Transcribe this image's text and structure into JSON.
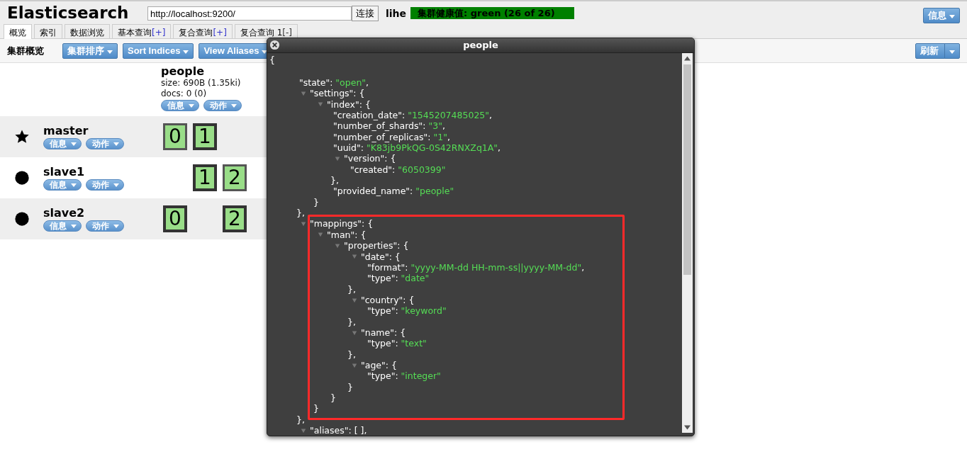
{
  "header": {
    "title": "Elasticsearch",
    "url": "http://localhost:9200/",
    "connect_button": "连接",
    "cluster_name": "lihe",
    "health": "集群健康值: green (26 of 26)",
    "info_button": "信息"
  },
  "tabs": [
    {
      "label": "概览",
      "selected": true
    },
    {
      "label": "索引",
      "selected": false
    },
    {
      "label": "数据浏览",
      "selected": false
    },
    {
      "label": "基本查询",
      "action": "[+]",
      "selected": false
    },
    {
      "label": "复合查询",
      "action": "[+]",
      "selected": false
    },
    {
      "label": "复合查询 1",
      "action": "[-]",
      "selected": false
    }
  ],
  "toolbar": {
    "title": "集群概览",
    "buttons": [
      "集群排序",
      "Sort Indices",
      "View Aliases"
    ],
    "refresh_button": "刷新"
  },
  "index": {
    "name": "people",
    "size": "size: 690B (1.35ki)",
    "docs": "docs: 0 (0)",
    "buttons": [
      "信息",
      "动作"
    ]
  },
  "nodes": [
    {
      "name": "master",
      "kind": "master",
      "buttons": [
        "信息",
        "动作"
      ],
      "slots": [
        {
          "kind": "shard",
          "label": "0",
          "primary": false
        },
        {
          "kind": "shard",
          "label": "1",
          "primary": true
        }
      ]
    },
    {
      "name": "slave1",
      "kind": "node",
      "buttons": [
        "信息",
        "动作"
      ],
      "slots": [
        {
          "kind": "blank"
        },
        {
          "kind": "shard",
          "label": "1",
          "primary": true
        },
        {
          "kind": "shard",
          "label": "2",
          "primary": false
        }
      ]
    },
    {
      "name": "slave2",
      "kind": "node",
      "buttons": [
        "信息",
        "动作"
      ],
      "slots": [
        {
          "kind": "shard",
          "label": "0",
          "primary": true
        },
        {
          "kind": "blank"
        },
        {
          "kind": "shard",
          "label": "2",
          "primary": true
        }
      ]
    }
  ],
  "modal": {
    "title": "people",
    "root": {
      "open": "{",
      "children": [
        {
          "key": "\"state\": ",
          "value": "\"open\"",
          "end": ","
        },
        {
          "key": "\"settings\": ",
          "open": "{",
          "expanded": true,
          "close": "},",
          "children": [
            {
              "key": "\"index\": ",
              "open": "{",
              "expanded": true,
              "close": "}",
              "children": [
                {
                  "key": "\"creation_date\": ",
                  "value": "\"1545207485025\"",
                  "end": ","
                },
                {
                  "key": "\"number_of_shards\": ",
                  "value": "\"3\"",
                  "end": ","
                },
                {
                  "key": "\"number_of_replicas\": ",
                  "value": "\"1\"",
                  "end": ","
                },
                {
                  "key": "\"uuid\": ",
                  "value": "\"K83jb9PkQG-0S42RNXZq1A\"",
                  "end": ","
                },
                {
                  "key": "\"version\": ",
                  "open": "{",
                  "expanded": true,
                  "close": "},",
                  "children": [
                    {
                      "key": "\"created\": ",
                      "value": "\"6050399\""
                    }
                  ]
                },
                {
                  "key": "\"provided_name\": ",
                  "value": "\"people\""
                }
              ]
            }
          ]
        },
        {
          "key": "\"mappings\": ",
          "open": "{",
          "expanded": true,
          "close": "},",
          "children": [
            {
              "key": "\"man\": ",
              "open": "{",
              "expanded": true,
              "close": "}",
              "children": [
                {
                  "key": "\"properties\": ",
                  "open": "{",
                  "expanded": true,
                  "close": "}",
                  "children": [
                    {
                      "key": "\"date\": ",
                      "open": "{",
                      "expanded": true,
                      "close": "},",
                      "children": [
                        {
                          "key": "\"format\": ",
                          "value": "\"yyyy-MM-dd HH-mm-ss||yyyy-MM-dd\"",
                          "end": ","
                        },
                        {
                          "key": "\"type\": ",
                          "value": "\"date\""
                        }
                      ]
                    },
                    {
                      "key": "\"country\": ",
                      "open": "{",
                      "expanded": true,
                      "close": "},",
                      "children": [
                        {
                          "key": "\"type\": ",
                          "value": "\"keyword\""
                        }
                      ]
                    },
                    {
                      "key": "\"name\": ",
                      "open": "{",
                      "expanded": true,
                      "close": "},",
                      "children": [
                        {
                          "key": "\"type\": ",
                          "value": "\"text\""
                        }
                      ]
                    },
                    {
                      "key": "\"age\": ",
                      "open": "{",
                      "expanded": true,
                      "close": "}",
                      "children": [
                        {
                          "key": "\"type\": ",
                          "value": "\"integer\""
                        }
                      ]
                    }
                  ]
                }
              ]
            }
          ]
        },
        {
          "key": "\"aliases\": ",
          "open": "[ ],",
          "expanded": true
        }
      ]
    }
  }
}
